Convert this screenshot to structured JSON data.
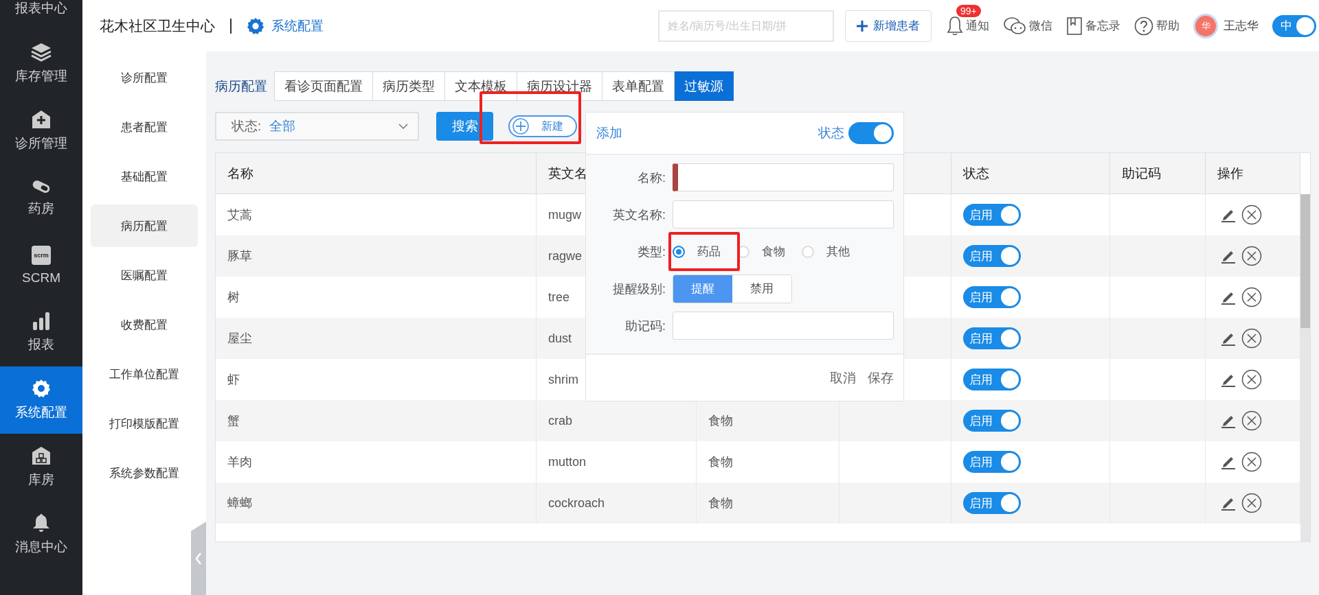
{
  "nav": {
    "items": [
      {
        "label": "报表中心",
        "selected": false
      },
      {
        "label": "库存管理",
        "selected": false
      },
      {
        "label": "诊所管理",
        "selected": false
      },
      {
        "label": "药房",
        "selected": false
      },
      {
        "label": "SCRM",
        "icon_text": "scrm",
        "selected": false
      },
      {
        "label": "报表",
        "selected": false
      },
      {
        "label": "系统配置",
        "selected": true
      },
      {
        "label": "库房",
        "selected": false
      },
      {
        "label": "消息中心",
        "selected": false
      }
    ]
  },
  "header": {
    "clinic_name": "花木社区卫生中心",
    "section": "系统配置",
    "search": {
      "placeholder": "姓名/病历号/出生日期/拼"
    },
    "new_patient": "新增患者",
    "tools": [
      {
        "kind": "bell",
        "label": "通知",
        "badge": "99+"
      },
      {
        "kind": "chat",
        "label": "微信"
      },
      {
        "kind": "book",
        "label": "备忘录"
      },
      {
        "kind": "help",
        "label": "帮助"
      }
    ],
    "user": {
      "avatar": "华",
      "name": "王志华"
    },
    "lang_toggle": {
      "label": "中",
      "on": true
    }
  },
  "sub_sidebar": {
    "items": [
      {
        "label": "诊所配置",
        "selected": false
      },
      {
        "label": "患者配置",
        "selected": false
      },
      {
        "label": "基础配置",
        "selected": false
      },
      {
        "label": "病历配置",
        "selected": true
      },
      {
        "label": "医嘱配置",
        "selected": false
      },
      {
        "label": "收费配置",
        "selected": false
      },
      {
        "label": "工作单位配置",
        "selected": false
      },
      {
        "label": "打印模版配置",
        "selected": false
      },
      {
        "label": "系统参数配置",
        "selected": false
      }
    ]
  },
  "tabs": {
    "group_label": "病历配置",
    "items": [
      {
        "label": "看诊页面配置",
        "selected": false
      },
      {
        "label": "病历类型",
        "selected": false
      },
      {
        "label": "文本模板",
        "selected": false
      },
      {
        "label": "病历设计器",
        "selected": false
      },
      {
        "label": "表单配置",
        "selected": false
      },
      {
        "label": "过敏源",
        "selected": true
      }
    ]
  },
  "toolbar": {
    "status_filter": {
      "label": "状态:",
      "value": "全部"
    },
    "search_button": "搜索",
    "new_button": "新建"
  },
  "table": {
    "columns": [
      "名称",
      "英文名",
      "",
      "",
      "状态",
      "助记码",
      "操作"
    ],
    "rows": [
      {
        "name": "艾蒿",
        "english": "mugw",
        "type": "",
        "status": {
          "label": "启用",
          "on": true
        }
      },
      {
        "name": "豚草",
        "english": "ragwe",
        "type": "",
        "status": {
          "label": "启用",
          "on": true
        }
      },
      {
        "name": "树",
        "english": "tree",
        "type": "",
        "status": {
          "label": "启用",
          "on": true
        }
      },
      {
        "name": "屋尘",
        "english": "dust",
        "type": "",
        "status": {
          "label": "启用",
          "on": true
        }
      },
      {
        "name": "虾",
        "english": "shrim",
        "type": "",
        "status": {
          "label": "启用",
          "on": true
        }
      },
      {
        "name": "蟹",
        "english": "crab",
        "type": "食物",
        "status": {
          "label": "启用",
          "on": true
        }
      },
      {
        "name": "羊肉",
        "english": "mutton",
        "type": "食物",
        "status": {
          "label": "启用",
          "on": true
        }
      },
      {
        "name": "蟑螂",
        "english": "cockroach",
        "type": "食物",
        "status": {
          "label": "启用",
          "on": true
        }
      }
    ]
  },
  "popup": {
    "title": "添加",
    "status_label": "状态",
    "status_on": true,
    "fields": [
      {
        "kind": "text",
        "label": "名称:",
        "invalid": true
      },
      {
        "kind": "text",
        "label": "英文名称:",
        "invalid": false
      },
      {
        "kind": "radio",
        "label": "类型:",
        "options": [
          {
            "label": "药品",
            "selected": true
          },
          {
            "label": "食物",
            "selected": false
          },
          {
            "label": "其他",
            "selected": false
          }
        ]
      },
      {
        "kind": "segmented",
        "label": "提醒级别:",
        "options": [
          {
            "label": "提醒",
            "selected": true
          },
          {
            "label": "禁用",
            "selected": false
          }
        ]
      },
      {
        "kind": "text",
        "label": "助记码:",
        "invalid": false
      }
    ],
    "cancel": "取消",
    "save": "保存"
  }
}
